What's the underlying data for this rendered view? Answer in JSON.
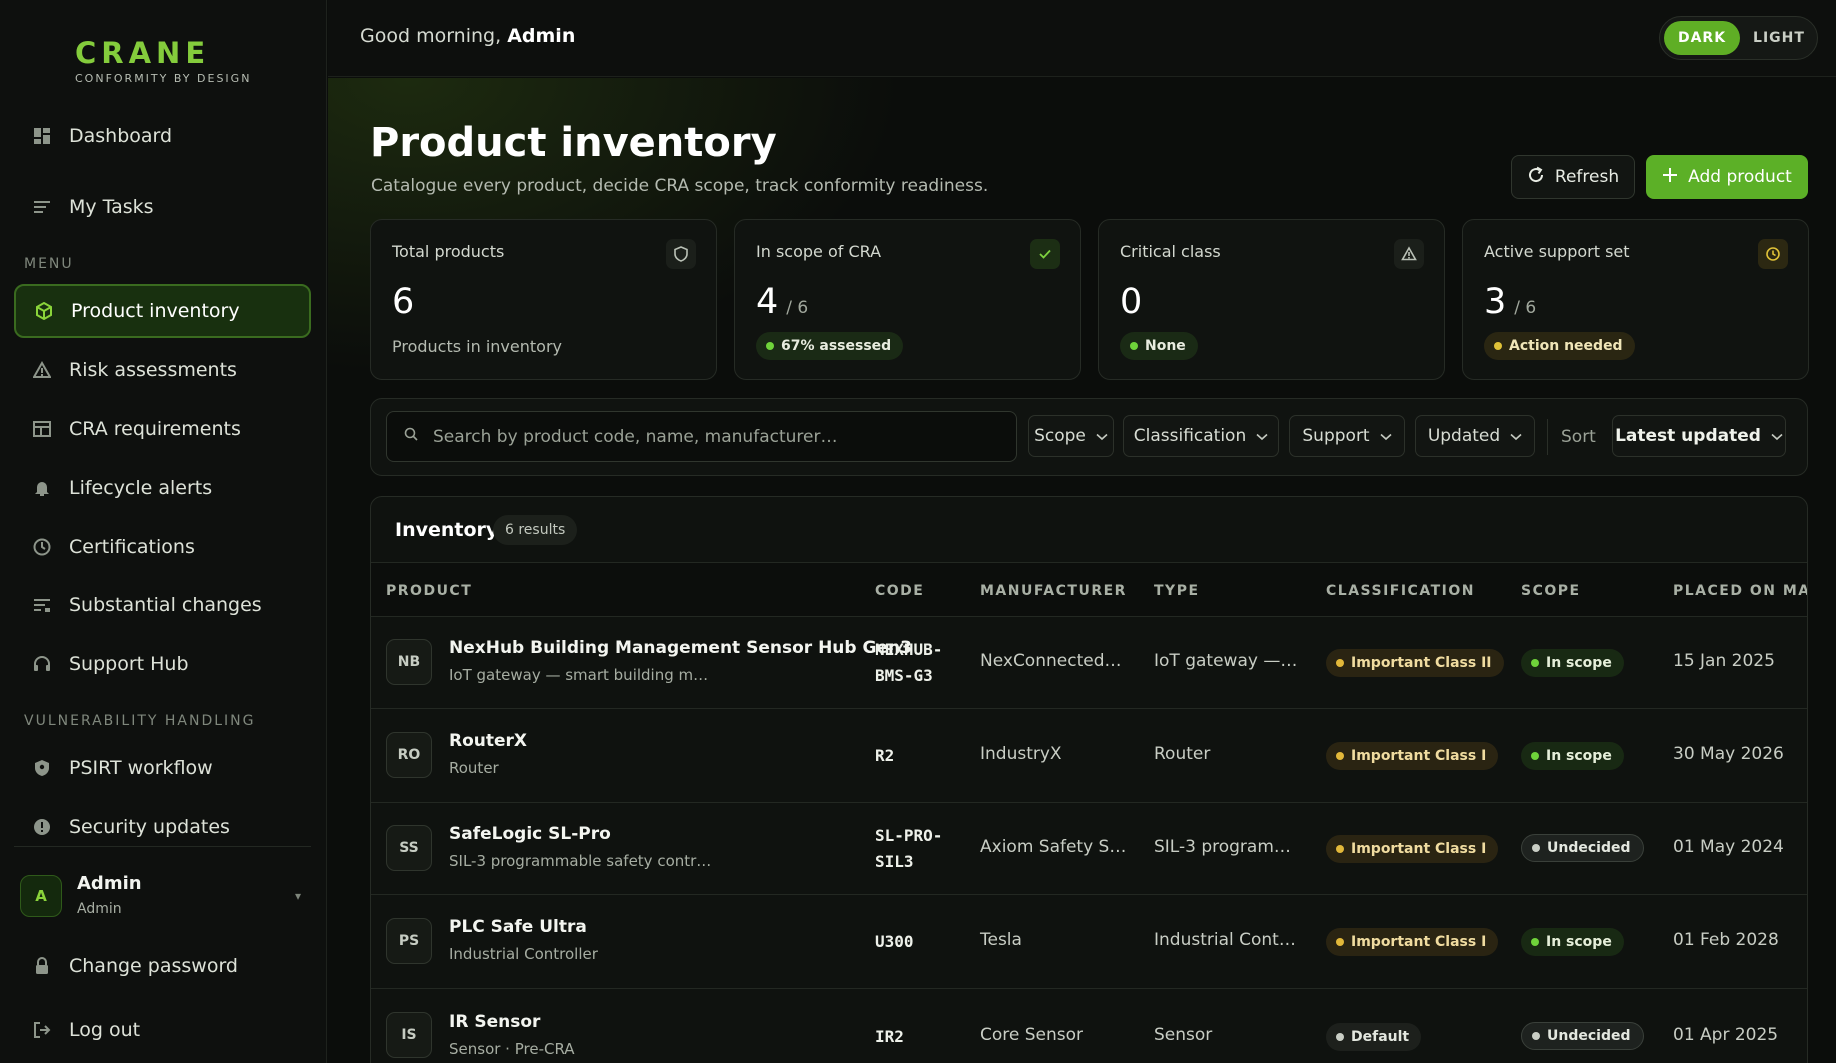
{
  "brand": {
    "name": "CRANE",
    "tagline": "CONFORMITY BY DESIGN"
  },
  "sidebar": {
    "top_items": [
      {
        "label": "Dashboard",
        "icon": "dashboard-icon"
      },
      {
        "label": "My Tasks",
        "icon": "tasks-icon"
      }
    ],
    "menu_label": "MENU",
    "menu_items": [
      {
        "label": "Product inventory",
        "icon": "box-icon",
        "active": true
      },
      {
        "label": "Risk assessments",
        "icon": "warning-icon"
      },
      {
        "label": "CRA requirements",
        "icon": "table-icon"
      },
      {
        "label": "Lifecycle alerts",
        "icon": "bell-icon"
      },
      {
        "label": "Certifications",
        "icon": "clock-icon"
      },
      {
        "label": "Substantial changes",
        "icon": "list-icon"
      },
      {
        "label": "Support Hub",
        "icon": "headset-icon"
      }
    ],
    "vuln_label": "VULNERABILITY HANDLING",
    "vuln_items": [
      {
        "label": "PSIRT workflow",
        "icon": "shield-icon"
      },
      {
        "label": "Security updates",
        "icon": "alert-circle-icon"
      }
    ],
    "user": {
      "initial": "A",
      "name": "Admin",
      "role": "Admin"
    },
    "bottom_items": [
      {
        "label": "Change password",
        "icon": "lock-icon"
      },
      {
        "label": "Log out",
        "icon": "logout-icon"
      }
    ]
  },
  "topbar": {
    "greeting_prefix": "Good morning,",
    "greeting_name": "Admin",
    "theme_dark": "DARK",
    "theme_light": "LIGHT"
  },
  "page": {
    "title": "Product inventory",
    "subtitle": "Catalogue every product, decide CRA scope, track conformity readiness.",
    "refresh_label": "Refresh",
    "add_label": "Add product"
  },
  "stats": [
    {
      "label": "Total products",
      "value": "6",
      "of": "",
      "foot": "Products in inventory",
      "pill": "",
      "icon": "shield-icon"
    },
    {
      "label": "In scope of CRA",
      "value": "4",
      "of": "/ 6",
      "foot": "",
      "pill": "67% assessed",
      "pill_tone": "green",
      "icon": "check-icon",
      "accent": "#5cb027"
    },
    {
      "label": "Critical class",
      "value": "0",
      "of": "",
      "foot": "",
      "pill": "None",
      "pill_tone": "green",
      "icon": "warning-icon"
    },
    {
      "label": "Active support set",
      "value": "3",
      "of": "/ 6",
      "foot": "",
      "pill": "Action needed",
      "pill_tone": "amber",
      "icon": "clock-icon",
      "accent": "#e0c238"
    }
  ],
  "filters": {
    "search_placeholder": "Search by product code, name, manufacturer…",
    "scope": "Scope",
    "classification": "Classification",
    "support": "Support",
    "updated": "Updated",
    "sort_label": "Sort",
    "sort_value": "Latest updated"
  },
  "inventory": {
    "title": "Inventory",
    "count": "6 results",
    "columns": [
      "PRODUCT",
      "CODE",
      "MANUFACTURER",
      "TYPE",
      "CLASSIFICATION",
      "SCOPE",
      "PLACED ON MARK"
    ],
    "rows": [
      {
        "initials": "NB",
        "name": "NexHub Building Management Sensor Hub Gen3",
        "sub": "IoT gateway — smart building m…",
        "code_lines": [
          "NEXHUB-",
          "BMS-G3"
        ],
        "manufacturer": "NexConnected…",
        "type": "IoT gateway —…",
        "classification": "Important Class II",
        "scope": "In scope",
        "placed": "15 Jan 2025"
      },
      {
        "initials": "RO",
        "name": "RouterX",
        "sub": "Router",
        "code_lines": [
          "R2"
        ],
        "manufacturer": "IndustryX",
        "type": "Router",
        "classification": "Important Class I",
        "scope": "In scope",
        "placed": "30 May 2026"
      },
      {
        "initials": "SS",
        "name": "SafeLogic SL-Pro",
        "sub": "SIL-3 programmable safety contr…",
        "code_lines": [
          "SL-PRO-",
          "SIL3"
        ],
        "manufacturer": "Axiom Safety S…",
        "type": "SIL-3 program…",
        "classification": "Important Class I",
        "scope": "Undecided",
        "placed": "01 May 2024"
      },
      {
        "initials": "PS",
        "name": "PLC Safe Ultra",
        "sub": "Industrial Controller",
        "code_lines": [
          "U300"
        ],
        "manufacturer": "Tesla",
        "type": "Industrial Cont…",
        "classification": "Important Class I",
        "scope": "In scope",
        "placed": "01 Feb 2028"
      },
      {
        "initials": "IS",
        "name": "IR Sensor",
        "sub": "Sensor · Pre-CRA",
        "code_lines": [
          "IR2"
        ],
        "manufacturer": "Core Sensor",
        "type": "Sensor",
        "classification": "Default",
        "scope": "Undecided",
        "placed": "01 Apr 2025"
      }
    ]
  }
}
